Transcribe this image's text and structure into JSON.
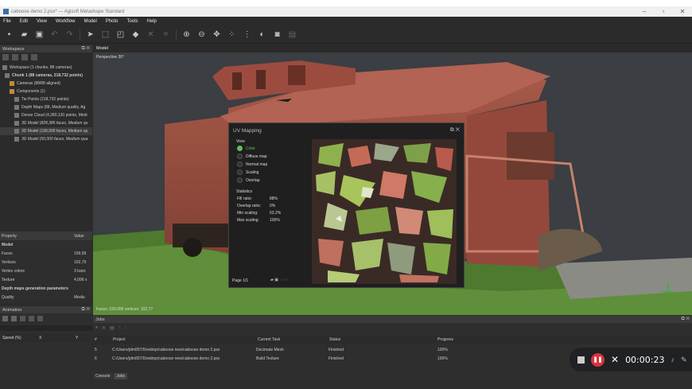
{
  "window": {
    "title": "caboose demo 2.psx* — Agisoft Metashape Standard"
  },
  "menu": [
    "File",
    "Edit",
    "View",
    "Workflow",
    "Model",
    "Photo",
    "Tools",
    "Help"
  ],
  "workspace": {
    "title": "Workspace",
    "items": [
      "Workspace (1 chunks, 88 cameras)",
      "Chunk 1 (88 cameras, 218,732 points)",
      "Cameras (88/88 aligned)",
      "Components (1)",
      "Tie Points (218,732 points)",
      "Depth Maps (88, Medium quality, Ag",
      "Dense Cloud (4,280,120 points, Medi",
      "3D Model (828,385 faces, Medium qu",
      "3D Model (199,999 faces, Medium qu",
      "3D Model (50,000 faces, Medium qua"
    ]
  },
  "properties": {
    "col_property": "Property",
    "col_value": "Value",
    "section": "Model",
    "rows": [
      {
        "k": "Faces",
        "v": "199,99"
      },
      {
        "k": "Vertices",
        "v": "102,79"
      },
      {
        "k": "Vertex colors",
        "v": "3 banc"
      },
      {
        "k": "Texture",
        "v": "4,096 x"
      }
    ],
    "section2": "Depth maps generation parameters",
    "row_quality": "Quality",
    "row_quality_v": "Mediu"
  },
  "animation": {
    "title": "Animation",
    "speed_label": "Speed (%)",
    "x_label": "X",
    "y_label": "Y"
  },
  "viewport": {
    "tab": "Model",
    "perspective": "Perspective 30°",
    "faces_status": "Faces: 199,999 vertices: 102,77"
  },
  "uv_dialog": {
    "title": "UV Mapping",
    "view_label": "View",
    "options": [
      "Color",
      "Diffuse map",
      "Normal map",
      "Scaling",
      "Overlap"
    ],
    "selected": "Color",
    "stats_label": "Statistics",
    "stats": [
      {
        "k": "Fill ratio:",
        "v": "88%"
      },
      {
        "k": "Overlap ratio:",
        "v": "0%"
      },
      {
        "k": "Min scaling:",
        "v": "63.2%"
      },
      {
        "k": "Max scaling:",
        "v": "100%"
      }
    ],
    "page": "Page 1/1"
  },
  "jobs": {
    "title": "Jobs",
    "headers": {
      "num": "#",
      "project": "Project",
      "task": "Current Task",
      "status": "Status",
      "progress": "Progress"
    },
    "rows": [
      {
        "num": "5",
        "project": "C:/Users/jdm007/Desktop/caboose new/caboose demo 2.psx",
        "task": "Decimate Mesh",
        "status": "Finished",
        "progress": "100%"
      },
      {
        "num": "6",
        "project": "C:/Users/jdm007/Desktop/caboose new/caboose demo 2.psx",
        "task": "Build Texture",
        "status": "Finished",
        "progress": "100%"
      }
    ],
    "tabs": [
      "Console",
      "Jobs"
    ]
  },
  "recorder": {
    "time": "00:00:23"
  },
  "colors": {
    "accent_green": "#59c25c",
    "record_red": "#d9333f"
  }
}
